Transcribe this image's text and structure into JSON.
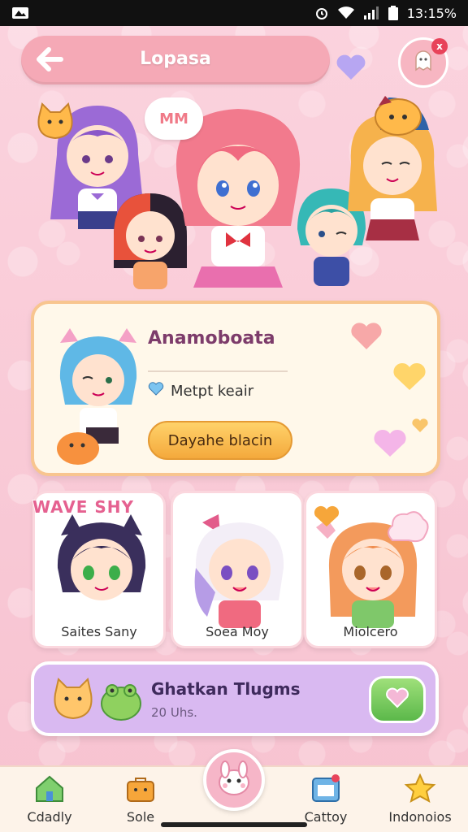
{
  "status_bar": {
    "time": "13:15%"
  },
  "header": {
    "title": "Lopasa",
    "notification_count": "x"
  },
  "hero": {
    "speech_text": "MM"
  },
  "featured": {
    "name": "Anamoboata",
    "meta": "Metpt keair",
    "button_label": "Dayahe blacin"
  },
  "characters": {
    "section_label": "WAVE SHY",
    "items": [
      {
        "name": "Saites Sany"
      },
      {
        "name": "Soea Moy"
      },
      {
        "name": "Miolcero"
      }
    ]
  },
  "banner": {
    "title": "Ghatkan Tlugms",
    "subtitle": "20 Uhs."
  },
  "nav": {
    "items": [
      {
        "label": "Cdadly"
      },
      {
        "label": "Sole"
      },
      {
        "label": "Cattoy"
      },
      {
        "label": "Indonoios"
      }
    ]
  },
  "colors": {
    "accent_pink": "#f5a9b6",
    "banner_purple": "#d9b9f1",
    "button_orange": "#f4a93c",
    "button_green": "#5bb84a"
  }
}
